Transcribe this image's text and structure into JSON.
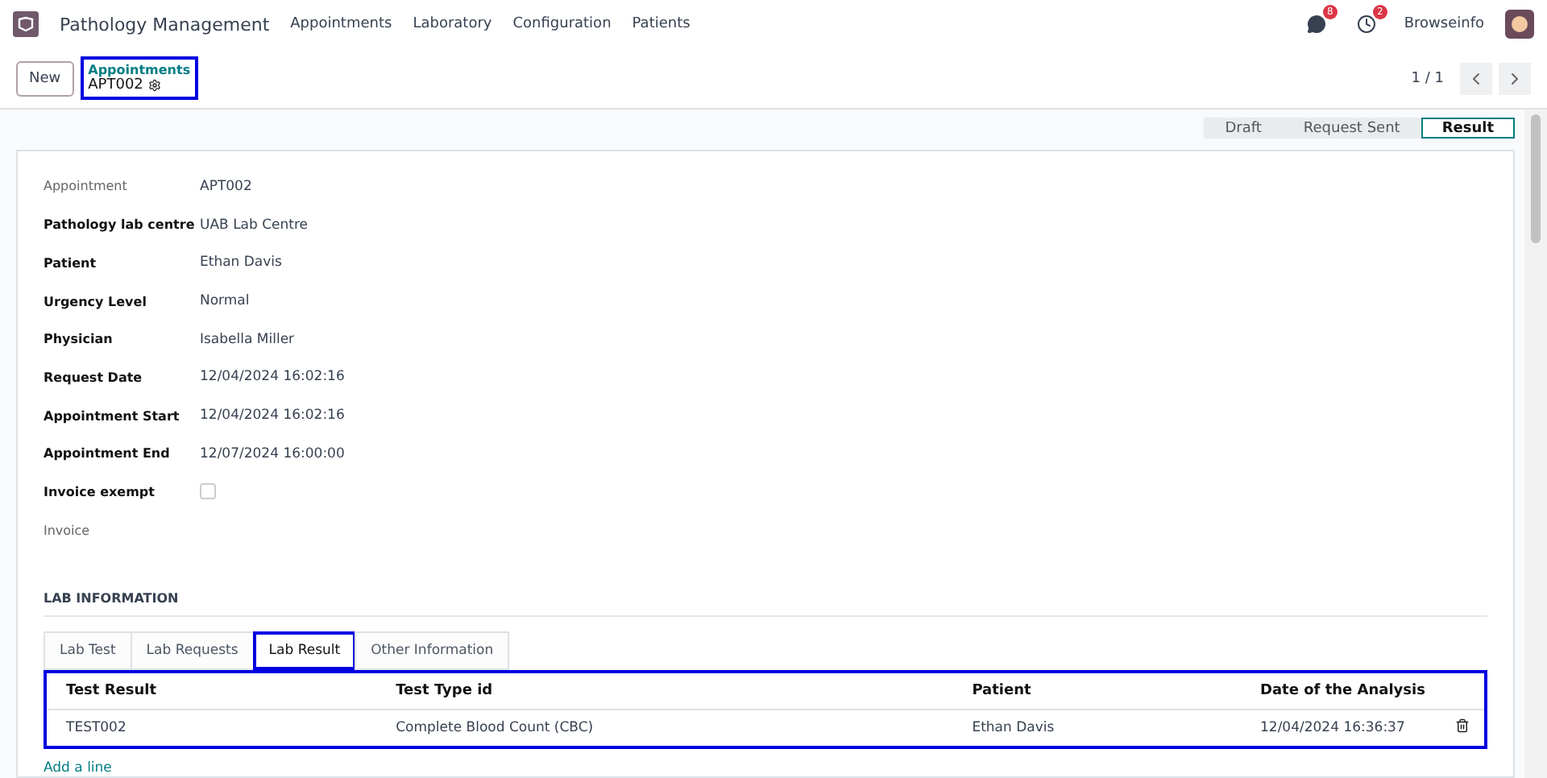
{
  "navbar": {
    "app_name": "Pathology Management",
    "menu": [
      "Appointments",
      "Laboratory",
      "Configuration",
      "Patients"
    ],
    "messages_count": "8",
    "activities_count": "2",
    "user": "Browseinfo"
  },
  "control_panel": {
    "new_button": "New",
    "breadcrumb": "Appointments",
    "record": "APT002",
    "highlighted": true,
    "pager": "1 / 1"
  },
  "status_steps": [
    {
      "label": "Draft",
      "selected": false
    },
    {
      "label": "Request Sent",
      "selected": false
    },
    {
      "label": "Result",
      "selected": true
    }
  ],
  "fields": [
    {
      "label": "Appointment",
      "value": "APT002",
      "required": false,
      "kind": "text"
    },
    {
      "label": "Pathology lab centre",
      "value": "UAB Lab Centre",
      "required": true,
      "kind": "text"
    },
    {
      "label": "Patient",
      "value": "Ethan Davis",
      "required": true,
      "kind": "text"
    },
    {
      "label": "Urgency Level",
      "value": "Normal",
      "required": true,
      "kind": "text"
    },
    {
      "label": "Physician",
      "value": "Isabella Miller",
      "required": true,
      "kind": "text"
    },
    {
      "label": "Request Date",
      "value": "12/04/2024 16:02:16",
      "required": true,
      "kind": "text"
    },
    {
      "label": "Appointment Start",
      "value": "12/04/2024 16:02:16",
      "required": true,
      "kind": "text"
    },
    {
      "label": "Appointment End",
      "value": "12/07/2024 16:00:00",
      "required": true,
      "kind": "text"
    },
    {
      "label": "Invoice exempt",
      "checked": false,
      "required": true,
      "kind": "checkbox"
    },
    {
      "label": "Invoice",
      "required": false,
      "kind": "empty"
    }
  ],
  "section_title": "LAB INFORMATION",
  "tabs": [
    {
      "label": "Lab Test",
      "selected": false,
      "highlighted": false
    },
    {
      "label": "Lab Requests",
      "selected": false,
      "highlighted": false
    },
    {
      "label": "Lab Result",
      "selected": true,
      "highlighted": true
    },
    {
      "label": "Other Information",
      "selected": false,
      "highlighted": false
    }
  ],
  "table": {
    "highlighted": true,
    "columns": [
      "Test Result",
      "Test Type id",
      "Patient",
      "Date of the Analysis"
    ],
    "rows": [
      [
        "TEST002",
        "Complete Blood Count (CBC)",
        "Ethan Davis",
        "12/04/2024 16:36:37"
      ]
    ],
    "add_line": "Add a line"
  }
}
